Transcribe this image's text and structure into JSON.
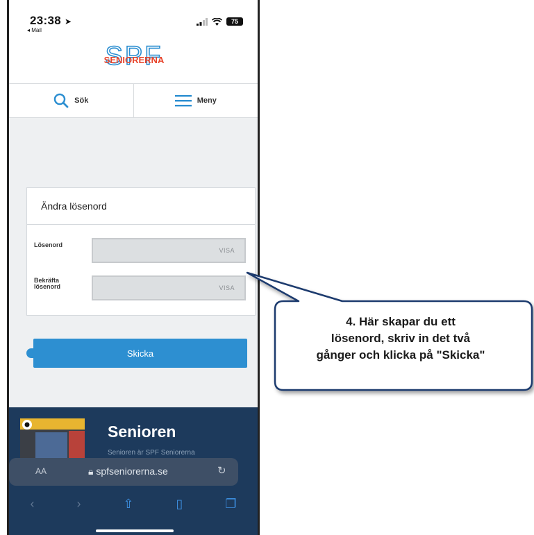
{
  "status_bar": {
    "time": "23:38",
    "back_app": "◂ Mail",
    "battery": "75"
  },
  "logo": {
    "top_letters": "SPF",
    "word": "SENIORERNA"
  },
  "nav": {
    "search_label": "Sök",
    "menu_label": "Meny"
  },
  "form": {
    "title": "Ändra lösenord",
    "password_label": "Lösenord",
    "confirm_label_line1": "Bekräfta",
    "confirm_label_line2": "lösenord",
    "show_label": "VISA",
    "submit_label": "Skicka"
  },
  "promo": {
    "title": "Senioren",
    "subtitle": "Senioren är SPF Seniorerna"
  },
  "browser": {
    "text_size_label": "AA",
    "url": "spfseniorerna.se"
  },
  "callout": {
    "line1": "4. Här skapar du ett",
    "line2": "lösenord, skriv in det två",
    "line3": "gånger och klicka på \"Skicka\""
  },
  "colors": {
    "brand_red": "#e8452c",
    "brand_blue": "#2d8fd1",
    "footer_navy": "#1d3a5c",
    "callout_border": "#1f3a6e"
  }
}
